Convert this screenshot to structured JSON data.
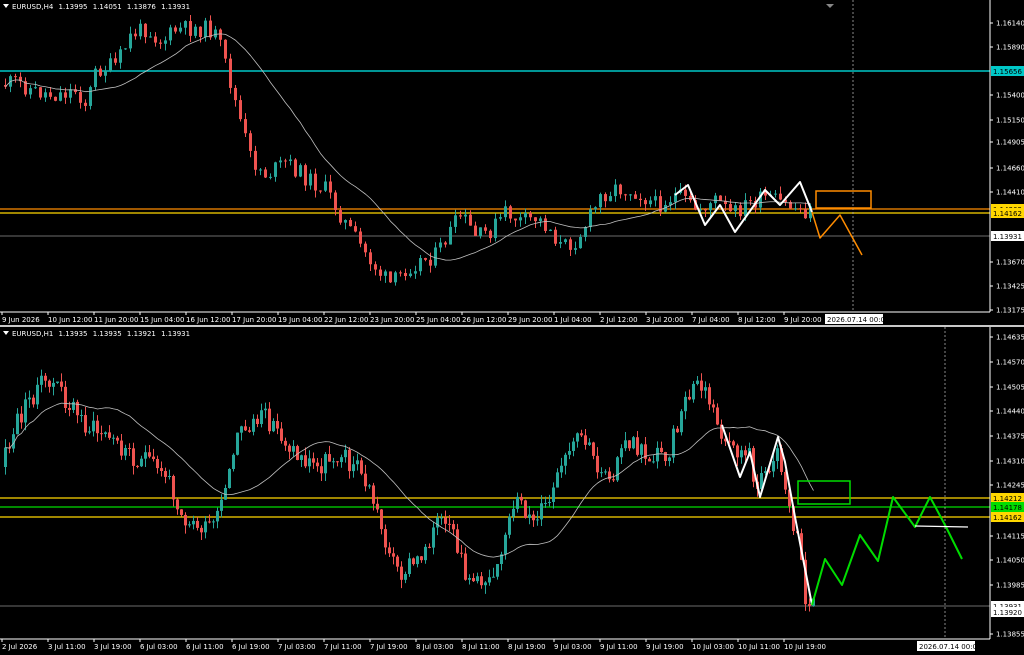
{
  "charts": [
    {
      "symbol": "EURUSD,H4",
      "open": "1.13995",
      "high": "1.14051",
      "low": "1.13876",
      "close": "1.13931",
      "price_ticks": [
        "1.16140",
        "1.15890",
        "1.15400",
        "1.15150",
        "1.14905",
        "1.14660",
        "1.14410",
        "1.13670",
        "1.13425",
        "1.13175"
      ],
      "time_ticks": [
        "9 Jun 2026",
        "10 Jun 12:00",
        "11 Jun 20:00",
        "15 Jun 04:00",
        "16 Jun 12:00",
        "17 Jun 20:00",
        "19 Jun 04:00",
        "22 Jun 12:00",
        "23 Jun 20:00",
        "25 Jun 04:00",
        "26 Jun 12:00",
        "29 Jun 20:00",
        "1 Jul 04:00",
        "2 Jul 12:00",
        "3 Jul 20:00",
        "7 Jul 04:00",
        "8 Jul 12:00",
        "9 Jul 20:00"
      ],
      "price_labels": [
        {
          "text": "1.15656",
          "bg": "#00c8c8",
          "fg": "#000000"
        },
        {
          "text": "1.14262",
          "bg": "#ffd700",
          "fg": "#000000"
        },
        {
          "text": "1.14162",
          "bg": "#ffd700",
          "fg": "#000000"
        },
        {
          "text": "1.13931",
          "bg": "#ffffff",
          "fg": "#000000"
        }
      ],
      "time_marker": "2026.07.14 00:00"
    },
    {
      "symbol": "EURUSD,H1",
      "open": "1.13935",
      "high": "1.13935",
      "low": "1.13921",
      "close": "1.13931",
      "price_ticks": [
        "1.14635",
        "1.14570",
        "1.14505",
        "1.14440",
        "1.14375",
        "1.14310",
        "1.14245",
        "1.14115",
        "1.14050",
        "1.13985",
        "1.13855"
      ],
      "time_ticks": [
        "2 Jul 2026",
        "3 Jul 11:00",
        "3 Jul 19:00",
        "6 Jul 03:00",
        "6 Jul 11:00",
        "6 Jul 19:00",
        "7 Jul 03:00",
        "7 Jul 11:00",
        "7 Jul 19:00",
        "8 Jul 03:00",
        "8 Jul 11:00",
        "8 Jul 19:00",
        "9 Jul 03:00",
        "9 Jul 11:00",
        "9 Jul 19:00",
        "10 Jul 03:00",
        "10 Jul 11:00",
        "10 Jul 19:00"
      ],
      "price_labels": [
        {
          "text": "1.14212",
          "bg": "#ffd700",
          "fg": "#000000"
        },
        {
          "text": "1.14178",
          "bg": "#00dd00",
          "fg": "#000000"
        },
        {
          "text": "1.14162",
          "bg": "#ffd700",
          "fg": "#000000"
        },
        {
          "text": "1.13931",
          "bg": "#ffffff",
          "fg": "#000000"
        },
        {
          "text": "1.13920",
          "bg": "#ffffff",
          "fg": "#000000"
        }
      ],
      "time_marker": "2026.07.14 00:00"
    }
  ],
  "colors": {
    "bull": "#26a69a",
    "bear": "#ef5350",
    "support": "#ffd700",
    "resistance": "#ff8c00",
    "cyan_level": "#00c8c8",
    "projection_h4": "#ff8c00",
    "projection_h1": "#00dd00",
    "wave": "#ffffff",
    "ma": "#c0c0c0"
  }
}
